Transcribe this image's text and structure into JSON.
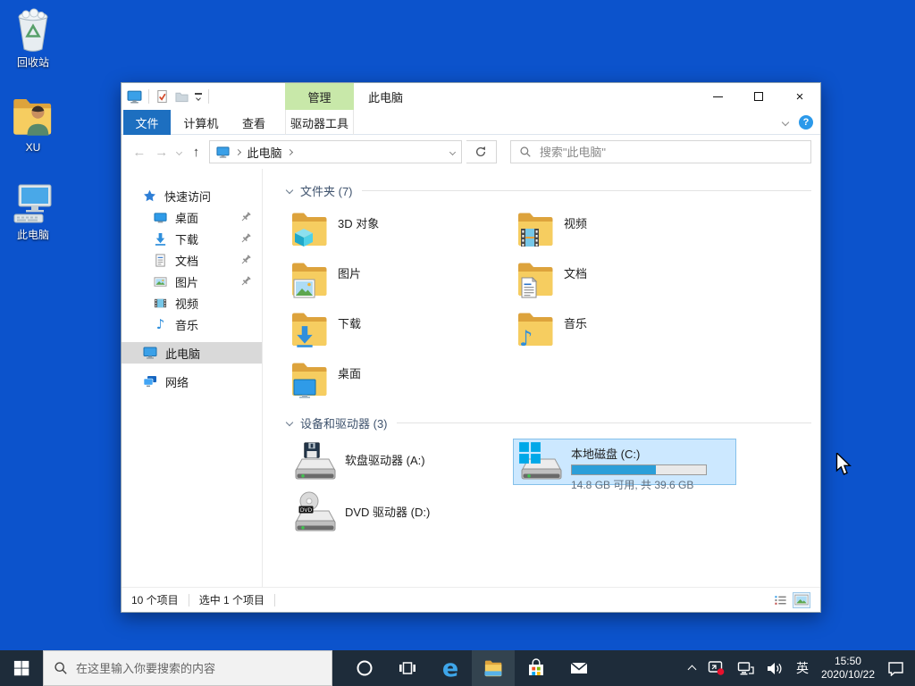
{
  "colors": {
    "desktop_bg": "#0c53cc",
    "taskbar_bg": "#1e2c3a",
    "accent_blue": "#1d6fc0",
    "contextual_green": "#c8e8a9",
    "selection_bg": "#cce8ff",
    "selection_border": "#84c0ea",
    "capacity_fill": "#2b9fd9"
  },
  "desktop": {
    "icons": [
      {
        "label": "回收站"
      },
      {
        "label": "XU"
      },
      {
        "label": "此电脑"
      }
    ]
  },
  "explorer": {
    "titlebar": {
      "title": "此电脑",
      "contextual_header": "管理"
    },
    "tabs": {
      "file": "文件",
      "computer": "计算机",
      "view": "查看",
      "drive_tools": "驱动器工具"
    },
    "address": {
      "path": "此电脑",
      "search_placeholder": "搜索\"此电脑\""
    },
    "sidebar": {
      "items": [
        {
          "label": "快速访问"
        },
        {
          "label": "桌面"
        },
        {
          "label": "下载"
        },
        {
          "label": "文档"
        },
        {
          "label": "图片"
        },
        {
          "label": "视频"
        },
        {
          "label": "音乐"
        },
        {
          "label": "此电脑"
        },
        {
          "label": "网络"
        }
      ]
    },
    "folders_section": {
      "title": "文件夹 (7)",
      "items": [
        {
          "label": "3D 对象"
        },
        {
          "label": "视频"
        },
        {
          "label": "图片"
        },
        {
          "label": "文档"
        },
        {
          "label": "下载"
        },
        {
          "label": "音乐"
        },
        {
          "label": "桌面"
        }
      ]
    },
    "devices_section": {
      "title": "设备和驱动器 (3)",
      "items": [
        {
          "label": "软盘驱动器 (A:)"
        },
        {
          "label": "本地磁盘 (C:)",
          "detail": "14.8 GB 可用, 共 39.6 GB",
          "used_percent": 62.6
        },
        {
          "label": "DVD 驱动器 (D:)"
        }
      ]
    },
    "statusbar": {
      "items_count": "10 个项目",
      "selected_count": "选中 1 个项目"
    }
  },
  "taskbar": {
    "search_placeholder": "在这里输入你要搜索的内容",
    "ime": "英",
    "time": "15:50",
    "date": "2020/10/22"
  }
}
